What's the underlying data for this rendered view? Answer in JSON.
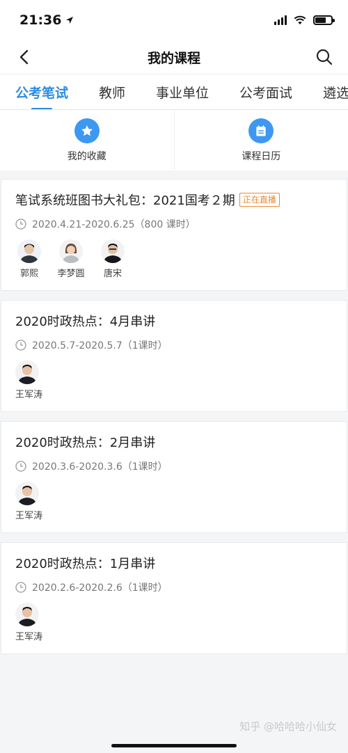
{
  "status": {
    "time": "21:36"
  },
  "nav": {
    "title": "我的课程"
  },
  "tabs": [
    {
      "label": "公考笔试",
      "active": true
    },
    {
      "label": "教师"
    },
    {
      "label": "事业单位"
    },
    {
      "label": "公考面试"
    },
    {
      "label": "遴选"
    }
  ],
  "quick": {
    "favorites": "我的收藏",
    "calendar": "课程日历"
  },
  "courses": [
    {
      "title": "笔试系统班图书大礼包：2021国考２期",
      "badge": "正在直播",
      "time": "2020.4.21-2020.6.25（800 课时）",
      "teachers": [
        "郭熙",
        "李梦圆",
        "唐宋"
      ]
    },
    {
      "title": "2020时政热点：4月串讲",
      "time": "2020.5.7-2020.5.7（1课时）",
      "teachers": [
        "王军涛"
      ]
    },
    {
      "title": "2020时政热点：2月串讲",
      "time": "2020.3.6-2020.3.6（1课时）",
      "teachers": [
        "王军涛"
      ]
    },
    {
      "title": "2020时政热点：1月串讲",
      "time": "2020.2.6-2020.2.6（1课时）",
      "teachers": [
        "王军涛"
      ]
    }
  ],
  "watermark": "知乎 @哈哈哈小仙女",
  "colors": {
    "accent": "#2b8de3",
    "badge": "#e58a35"
  }
}
